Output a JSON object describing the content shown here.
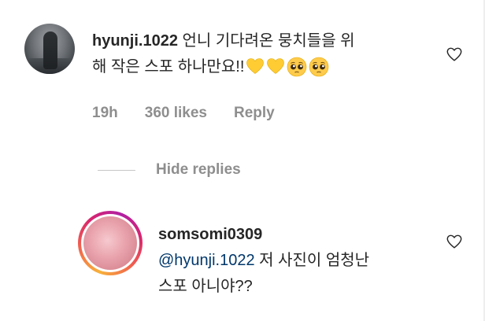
{
  "comment": {
    "username": "hyunji.1022",
    "text_line1": "언니 기다려온 뭉치들을 위",
    "text_line2": "해 작은 스포 하나만요!!",
    "emojis": [
      "yellow-heart",
      "yellow-heart",
      "pleading-face",
      "pleading-face"
    ],
    "time": "19h",
    "likes": "360 likes",
    "reply_label": "Reply",
    "like_icon": "heart-outline-icon"
  },
  "replies_toggle": {
    "label": "Hide replies"
  },
  "reply": {
    "username": "somsomi0309",
    "mention": "@hyunji.1022",
    "text_line1": " 저 사진이 엄청난",
    "text_line2": "스포 아니야??",
    "like_icon": "heart-outline-icon"
  },
  "colors": {
    "text": "#262626",
    "secondary": "#8e8e8e",
    "mention": "#00376b",
    "heart_yellow": "#ffcc33"
  }
}
